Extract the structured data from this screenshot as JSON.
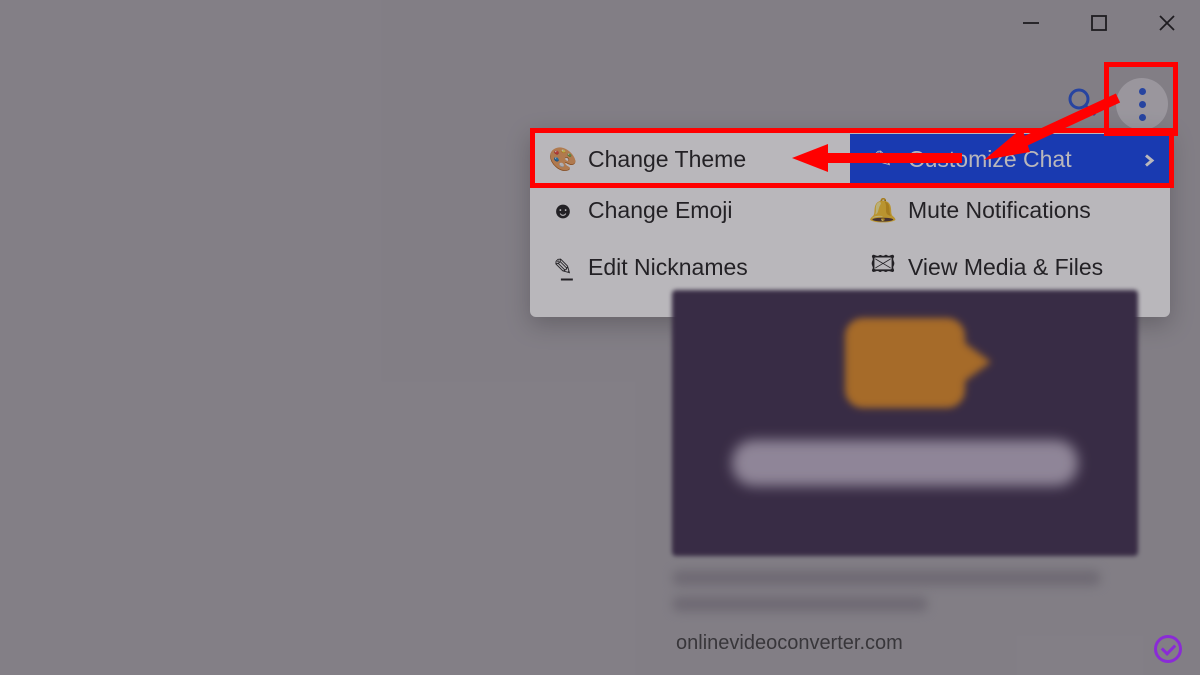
{
  "window_controls": {
    "minimize": "Minimize",
    "maximize": "Maximize",
    "close": "Close"
  },
  "top": {
    "search": "Search",
    "more": "More options"
  },
  "menu": {
    "change_theme": "Change Theme",
    "customize_chat": "Customize Chat",
    "change_emoji": "Change Emoji",
    "mute_notifications": "Mute Notifications",
    "edit_nicknames": "Edit Nicknames",
    "view_media_files": "View Media & Files"
  },
  "link_preview": {
    "domain": "onlinevideoconverter.com"
  }
}
